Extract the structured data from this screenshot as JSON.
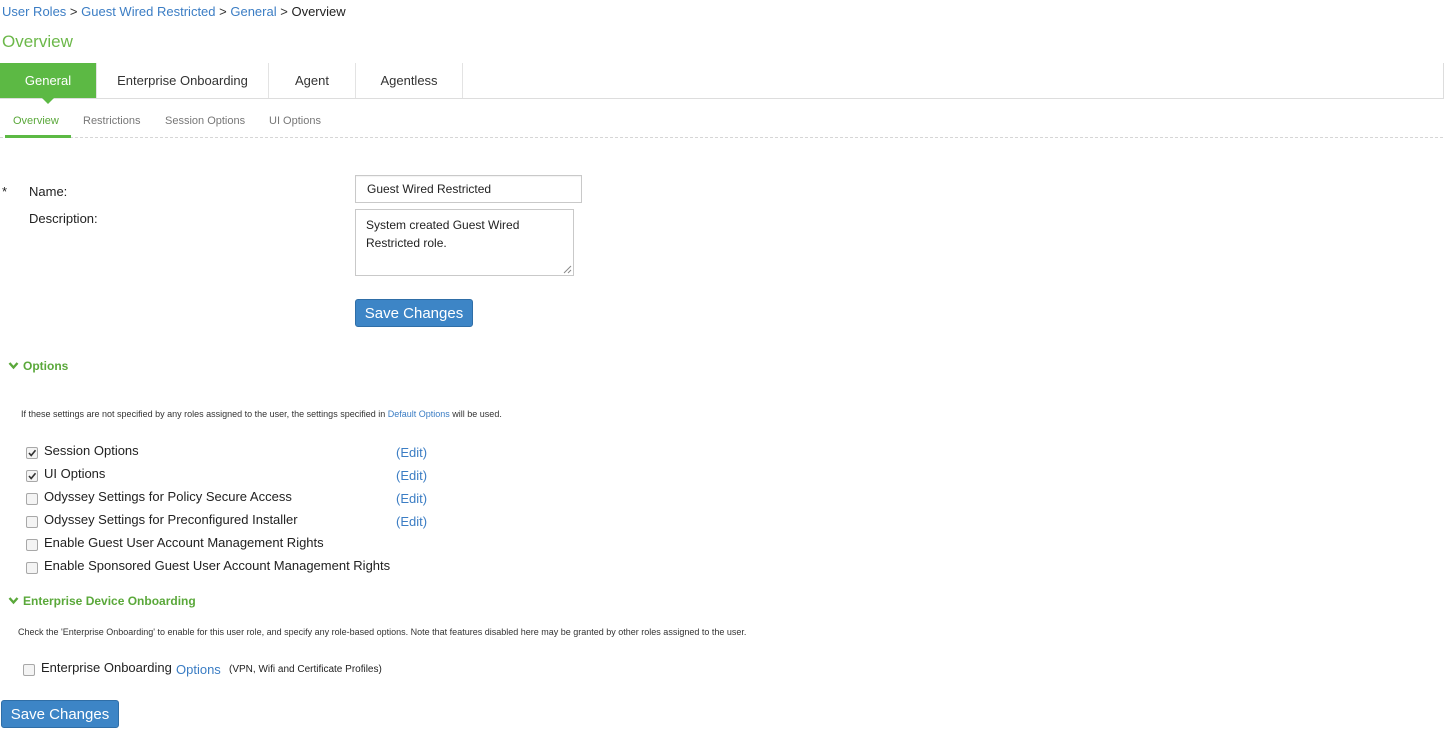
{
  "breadcrumb": {
    "items": [
      "User Roles",
      "Guest Wired Restricted",
      "General"
    ],
    "separator": ">",
    "current": "Overview"
  },
  "page_title": "Overview",
  "tabs": [
    {
      "label": "General",
      "active": true
    },
    {
      "label": "Enterprise Onboarding",
      "active": false
    },
    {
      "label": "Agent",
      "active": false
    },
    {
      "label": "Agentless",
      "active": false
    }
  ],
  "subtabs": [
    {
      "label": "Overview",
      "active": true
    },
    {
      "label": "Restrictions",
      "active": false
    },
    {
      "label": "Session Options",
      "active": false
    },
    {
      "label": "UI Options",
      "active": false
    }
  ],
  "form": {
    "required_mark": "*",
    "name_label": "Name:",
    "name_value": "Guest Wired Restricted",
    "description_label": "Description:",
    "description_value": "System created Guest Wired Restricted role.",
    "save_label": "Save Changes"
  },
  "options": {
    "header": "Options",
    "note_before": "If these settings are not specified by any roles assigned to the user, the settings specified in",
    "note_link": "Default Options",
    "note_after": "will be used.",
    "items": [
      {
        "label": "Session Options",
        "checked": true,
        "edit": "Edit"
      },
      {
        "label": "UI Options",
        "checked": true,
        "edit": "Edit"
      },
      {
        "label": "Odyssey Settings for Policy Secure Access",
        "checked": false,
        "edit": "Edit"
      },
      {
        "label": "Odyssey Settings for Preconfigured Installer",
        "checked": false,
        "edit": "Edit"
      },
      {
        "label": "Enable Guest User Account Management Rights",
        "checked": false
      },
      {
        "label": "Enable Sponsored Guest User Account Management Rights",
        "checked": false
      }
    ]
  },
  "enterprise": {
    "header": "Enterprise Device Onboarding",
    "note": "Check the 'Enterprise Onboarding' to enable for this user role, and specify any role-based options. Note that features disabled here may be granted by other roles assigned to the user.",
    "item_label": "Enterprise Onboarding",
    "item_checked": false,
    "options_link": "Options",
    "options_hint": "(VPN, Wifi and Certificate Profiles)"
  },
  "footer": {
    "save_label": "Save Changes"
  },
  "colors": {
    "accent_green": "#5cb944",
    "link_blue": "#3b7dc4",
    "button_blue": "#3d85c6"
  }
}
